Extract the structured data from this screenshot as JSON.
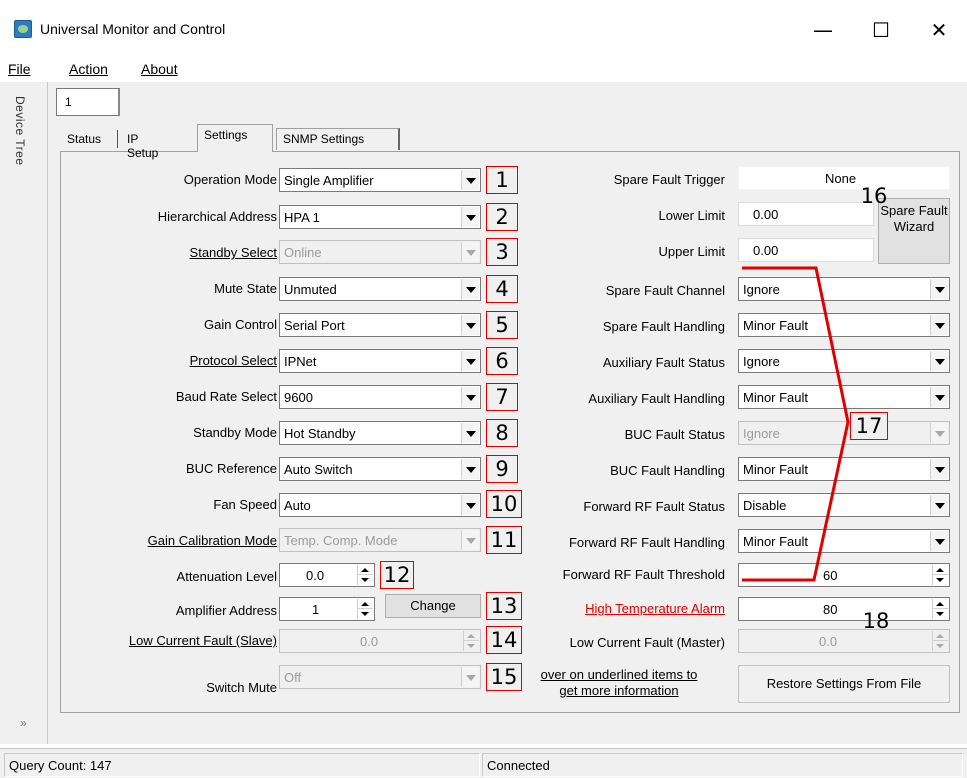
{
  "window": {
    "title": "Universal Monitor and Control",
    "min_glyph": "—",
    "max_glyph": "☐",
    "close_glyph": "✕"
  },
  "menu": {
    "file": "File",
    "action": "Action",
    "about": "About"
  },
  "sidebar": {
    "label": "Device Tree",
    "collapse_glyph": "»"
  },
  "device_tab": "1",
  "tabs": [
    "Status",
    "IP Setup",
    "Settings",
    "SNMP Settings"
  ],
  "active_tab": "Settings",
  "left_fields": [
    {
      "label": "Operation Mode",
      "value": "Single Amplifier",
      "marker": "1"
    },
    {
      "label": "Hierarchical Address",
      "value": "HPA 1",
      "marker": "2"
    },
    {
      "label": "Standby Select",
      "value": "Online",
      "marker": "3"
    },
    {
      "label": "Mute State",
      "value": "Unmuted",
      "marker": "4"
    },
    {
      "label": "Gain Control",
      "value": "Serial Port",
      "marker": "5"
    },
    {
      "label": "Protocol Select",
      "value": "IPNet",
      "marker": "6"
    },
    {
      "label": "Baud Rate Select",
      "value": "9600",
      "marker": "7"
    },
    {
      "label": "Standby Mode",
      "value": "Hot Standby",
      "marker": "8"
    },
    {
      "label": "BUC Reference",
      "value": "Auto Switch",
      "marker": "9"
    },
    {
      "label": "Fan Speed",
      "value": "Auto",
      "marker": "10"
    },
    {
      "label": "Gain Calibration Mode",
      "value": "Temp. Comp. Mode",
      "marker": "11"
    },
    {
      "label": "Attenuation Level",
      "value": "0.0",
      "marker": "12"
    },
    {
      "label": "Amplifier Address",
      "value": "1",
      "marker": "13",
      "button": "Change"
    },
    {
      "label": "Low Current Fault (Slave)",
      "value": "0.0",
      "marker": "14"
    },
    {
      "label": "Switch Mute",
      "value": "Off",
      "marker": "15"
    }
  ],
  "hover_hint": "Hover on underlined items to get more information",
  "hover_hint_line1": "over on underlined items to",
  "hover_hint_line2": "get more information",
  "right_top": {
    "spare_fault_trigger_label": "Spare Fault Trigger",
    "spare_fault_trigger_value": "None",
    "lower_limit_label": "Lower Limit",
    "lower_limit_value": "0.00",
    "upper_limit_label": "Upper Limit",
    "upper_limit_value": "0.00",
    "wizard_button": "Spare Fault Wizard",
    "marker": "16"
  },
  "right_fields": [
    {
      "label": "Spare Fault Channel",
      "value": "Ignore"
    },
    {
      "label": "Spare Fault Handling",
      "value": "Minor Fault"
    },
    {
      "label": "Auxiliary Fault Status",
      "value": "Ignore"
    },
    {
      "label": "Auxiliary Fault Handling",
      "value": "Minor Fault"
    },
    {
      "label": "BUC Fault Status",
      "value": "Ignore"
    },
    {
      "label": "BUC Fault Handling",
      "value": "Minor Fault"
    },
    {
      "label": "Forward RF Fault Status",
      "value": "Disable"
    },
    {
      "label": "Forward RF Fault Handling",
      "value": "Minor Fault"
    },
    {
      "label": "Forward RF Fault Threshold",
      "value": "60"
    },
    {
      "label": "High Temperature Alarm",
      "value": "80"
    },
    {
      "label": "Low Current Fault (Master)",
      "value": "0.0"
    }
  ],
  "markers_right": {
    "group": "17",
    "temp": "18"
  },
  "restore_button": "Restore Settings From File",
  "status": {
    "query_count": "Query Count: 147",
    "connection": "Connected"
  },
  "colors": {
    "annotation": "#e00000",
    "alarm_label": "#e00000"
  }
}
